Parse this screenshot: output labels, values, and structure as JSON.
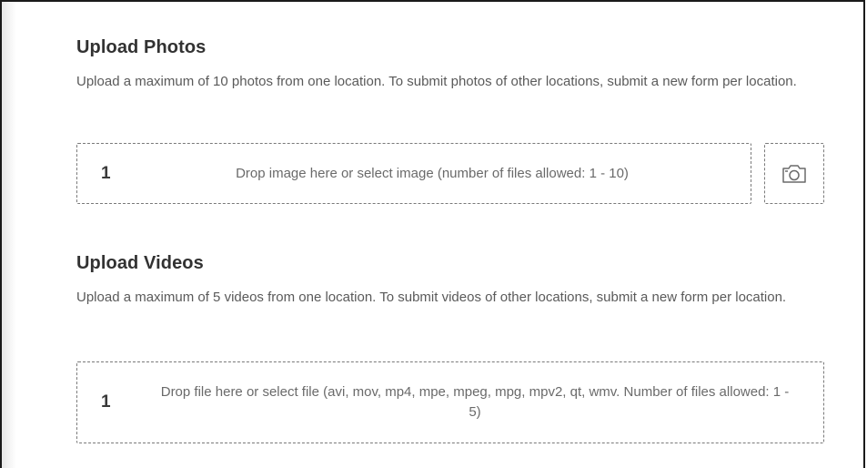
{
  "photos": {
    "title": "Upload Photos",
    "description": "Upload a maximum of 10 photos from one location. To submit photos of other locations, submit a new form per location.",
    "dropzone_count": "1",
    "dropzone_text": "Drop image here or select image (number of files allowed: 1 - 10)",
    "camera_icon": "camera-icon"
  },
  "videos": {
    "title": "Upload Videos",
    "description": "Upload a maximum of 5 videos from one location. To submit videos of other locations, submit a new form per location.",
    "dropzone_count": "1",
    "dropzone_text": "Drop file here or select file (avi, mov, mp4, mpe, mpeg, mpg, mpv2, qt, wmv. Number of files allowed: 1 - 5)"
  },
  "colors": {
    "title_text": "#323232",
    "body_text": "#5a5a5a",
    "dashed_border": "#7a7a7a"
  }
}
